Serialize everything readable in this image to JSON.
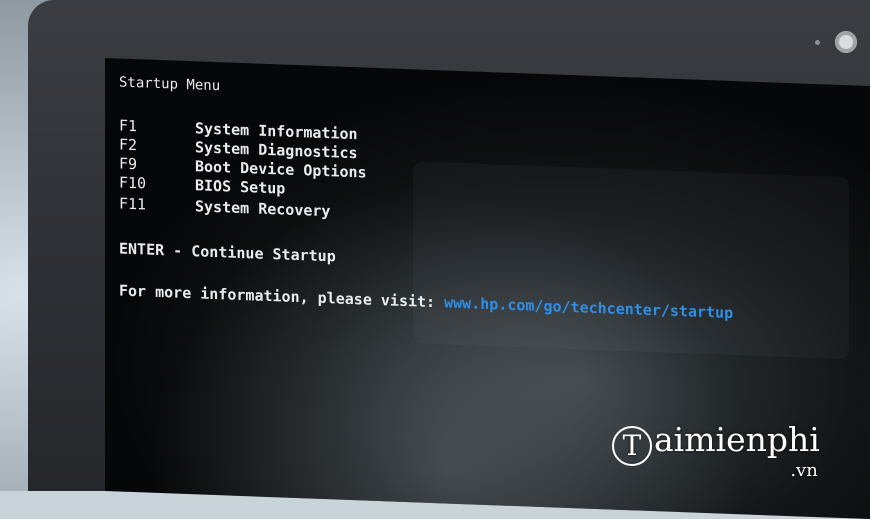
{
  "startup_menu": {
    "title": "Startup Menu",
    "options": [
      {
        "key": "F1",
        "label": "System Information"
      },
      {
        "key": "F2",
        "label": "System Diagnostics"
      },
      {
        "key": "F9",
        "label": "Boot Device Options"
      },
      {
        "key": "F10",
        "label": "BIOS Setup"
      },
      {
        "key": "F11",
        "label": "System Recovery"
      }
    ],
    "enter_line": "ENTER - Continue Startup",
    "info_prefix": "For more information, please visit:",
    "info_url": "www.hp.com/go/techcenter/startup"
  },
  "watermark": {
    "logo_letter": "T",
    "brand": "aimienphi",
    "suffix": ".vn"
  },
  "colors": {
    "screen_text": "#e8ecef",
    "link": "#2f8fe6",
    "screen_bg": "#050708"
  }
}
